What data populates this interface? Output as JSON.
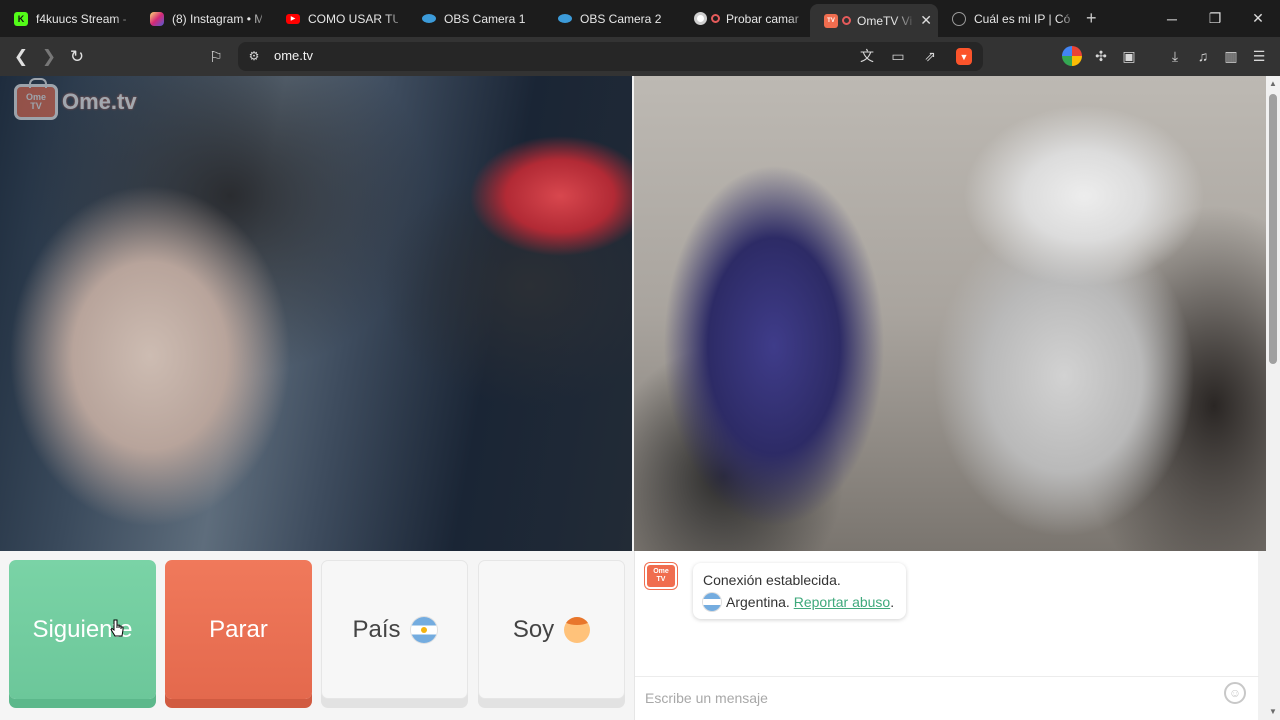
{
  "tabs": [
    {
      "label": "f4kuucs Stream - ",
      "icon": "kick-icon",
      "color": "#53fc18"
    },
    {
      "label": "(8) Instagram • M",
      "icon": "instagram-icon",
      "color": "#e1306c"
    },
    {
      "label": "COMO USAR TU C",
      "icon": "youtube-icon",
      "color": "#ff0000"
    },
    {
      "label": "OBS Camera 1",
      "icon": "obs-icon",
      "color": "#3c9bd9"
    },
    {
      "label": "OBS Camera 2",
      "icon": "obs-icon",
      "color": "#3c9bd9"
    },
    {
      "label": "Probar camar",
      "icon": "webcam-icon",
      "color": "#ffffff"
    },
    {
      "label": "OmeTV Vi",
      "icon": "ometv-icon",
      "color": "#f06d4f",
      "active": true
    },
    {
      "label": "Cuál es mi IP | Có",
      "icon": "globe-icon",
      "color": "#9a9a9a"
    }
  ],
  "address": {
    "url": "ome.tv"
  },
  "brave_badge": "2",
  "logo": {
    "tv_line1": "Ome",
    "tv_line2": "TV",
    "wordmark": "Ome.tv"
  },
  "buttons": {
    "next": "Siguiente",
    "stop": "Parar",
    "country": "País",
    "soy": "Soy"
  },
  "chat": {
    "status": "Conexión establecida.",
    "country": "Argentina.",
    "report_link": "Reportar abuso",
    "report_suffix": ".",
    "input_placeholder": "Escribe un mensaje"
  },
  "colors": {
    "next_green": "#6cc79a",
    "stop_red": "#e4694d",
    "brand_orange": "#f06d4f",
    "link_green": "#3fa97c"
  }
}
